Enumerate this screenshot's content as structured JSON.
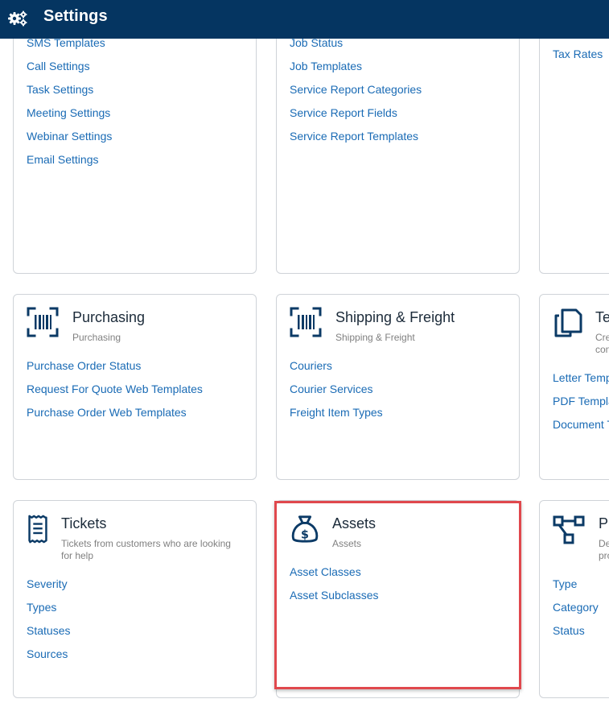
{
  "header": {
    "title": "Settings"
  },
  "col1": {
    "general": {
      "links": [
        "SMS Templates",
        "Call Settings",
        "Task Settings",
        "Meeting Settings",
        "Webinar Settings",
        "Email Settings"
      ]
    },
    "tickets": {
      "title": "Tickets",
      "subtitle": "Tickets from customers who are looking for help",
      "links": [
        "Severity",
        "Types",
        "Statuses",
        "Sources"
      ]
    },
    "purchasing": {
      "title": "Purchasing",
      "subtitle": "Purchasing",
      "links": [
        "Purchase Order Status",
        "Request For Quote Web Templates",
        "Purchase Order Web Templates"
      ]
    }
  },
  "col2": {
    "jobs": {
      "links": [
        "Job Status",
        "Job Templates",
        "Service Report Categories",
        "Service Report Fields",
        "Service Report Templates"
      ]
    },
    "shipping": {
      "title": "Shipping & Freight",
      "subtitle": "Shipping & Freight",
      "links": [
        "Couriers",
        "Courier Services",
        "Freight Item Types"
      ]
    },
    "assets": {
      "title": "Assets",
      "subtitle": "Assets",
      "links": [
        "Asset Classes",
        "Asset Subclasses"
      ]
    }
  },
  "col3": {
    "tax": {
      "links": [
        "Tax Rates"
      ]
    },
    "templates": {
      "title": "Te",
      "subtitle_lines": [
        "Cre",
        "con"
      ],
      "links": [
        "Letter Temp",
        "PDF Templa",
        "Document T"
      ]
    },
    "process": {
      "title": "Pr",
      "subtitle_lines": [
        "De",
        "pro"
      ],
      "links": [
        "Type",
        "Category",
        "Status"
      ]
    }
  },
  "colors": {
    "header_bg": "#053561",
    "link": "#1a6bb5",
    "icon": "#0b3a66",
    "highlight": "#e0484d"
  },
  "icons": {
    "header": "gears-icon",
    "purchasing": "barcode-icon",
    "shipping": "barcode-icon",
    "templates": "copy-icon",
    "tickets": "receipt-icon",
    "assets": "money-bag-icon",
    "process": "workflow-icon"
  }
}
